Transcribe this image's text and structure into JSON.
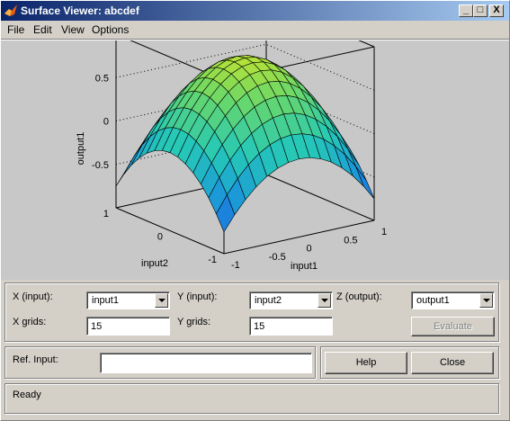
{
  "window": {
    "title": "Surface Viewer: abcdef"
  },
  "titlebar_buttons": {
    "minimize": "_",
    "maximize": "□",
    "close": "X"
  },
  "menu": [
    "File",
    "Edit",
    "View",
    "Options"
  ],
  "plot": {
    "zlabel": "output1",
    "xlabel": "input1",
    "ylabel": "input2",
    "z_ticks": [
      "0.5",
      "0",
      "-0.5"
    ],
    "x_ticks": [
      "-1",
      "-0.5",
      "0",
      "0.5",
      "1"
    ],
    "y_ticks": [
      "1",
      "0",
      "-1"
    ]
  },
  "chart_data": {
    "type": "surface",
    "xlabel": "input1",
    "ylabel": "input2",
    "zlabel": "output1",
    "xlim": [
      -1,
      1
    ],
    "ylim": [
      -1,
      1
    ],
    "zlim": [
      -1,
      1
    ],
    "grid_points": 15,
    "colormap": [
      "#1e3fc8",
      "#1a8fe0",
      "#25c8b8",
      "#6ad868",
      "#e8e818"
    ]
  },
  "controls": {
    "x_input_label": "X (input):",
    "x_input_value": "input1",
    "y_input_label": "Y (input):",
    "y_input_value": "input2",
    "z_output_label": "Z (output):",
    "z_output_value": "output1",
    "x_grids_label": "X grids:",
    "x_grids_value": "15",
    "y_grids_label": "Y grids:",
    "y_grids_value": "15",
    "evaluate_label": "Evaluate",
    "ref_input_label": "Ref. Input:",
    "ref_input_value": "",
    "help_label": "Help",
    "close_label": "Close"
  },
  "status": {
    "text": "Ready"
  }
}
